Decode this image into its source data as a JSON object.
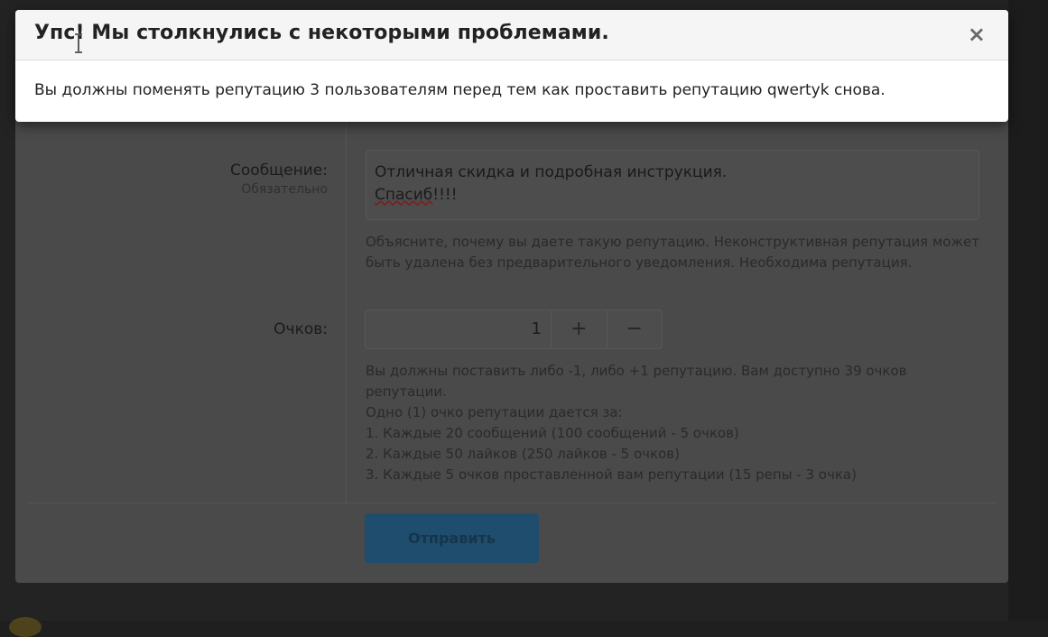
{
  "dialog": {
    "title": "Упс! Мы столкнулись с некоторыми проблемами.",
    "close_icon": "×",
    "message": "Вы должны поменять репутацию 3 пользователям перед тем как проставить репутацию qwertyk снова."
  },
  "form": {
    "message_label": "Сообщение:",
    "message_required": "Обязательно",
    "message_value_line1": "Отличная скидка и подробная инструкция.",
    "message_value_line2": "Спасиб",
    "message_value_line2_tail": "!!!!",
    "message_hint": "Объясните, почему вы даете такую репутацию. Неконструктивная репутация может быть удалена без предварительного уведомления. Необходима репутация.",
    "points_label": "Очков:",
    "points_value": "1",
    "plus_label": "+",
    "minus_label": "−",
    "points_hint_line1": "Вы должны поставить либо -1, либо +1 репутацию. Вам доступно 39 очков репутации.",
    "points_hint_line2": "Одно (1) очко репутации дается за:",
    "points_hint_line3": "1. Каждые 20 сообщений (100 сообщений - 5 очков)",
    "points_hint_line4": "2. Каждые 50 лайков (250 лайков - 5 очков)",
    "points_hint_line5": "3. Каждые 5 очков проставленной вам репутации (15 репы - 3 очка)",
    "submit_label": "Отправить"
  },
  "colors": {
    "submit_button": "#1e4d6d",
    "overlay": "#4a4a4a",
    "dialog_header": "#f5f5f5"
  }
}
